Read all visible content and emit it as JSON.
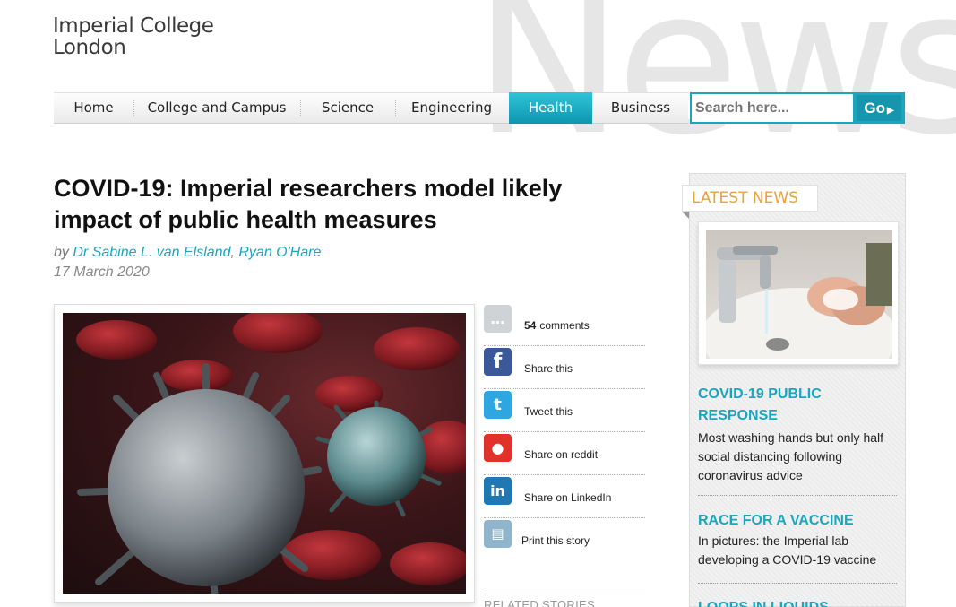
{
  "header": {
    "logo_line1": "Imperial College",
    "logo_line2": "London",
    "watermark": "News"
  },
  "nav": {
    "items": [
      {
        "label": "Home",
        "active": false
      },
      {
        "label": "College and Campus",
        "active": false
      },
      {
        "label": "Science",
        "active": false
      },
      {
        "label": "Engineering",
        "active": false
      },
      {
        "label": "Health",
        "active": true
      },
      {
        "label": "Business",
        "active": false
      }
    ],
    "search_placeholder": "Search here...",
    "search_button": "Go",
    "accent_color": "#1aa6bf"
  },
  "article": {
    "headline": "COVID-19: Imperial researchers model likely impact of public health measures",
    "by_label": "by",
    "author1": "Dr Sabine L. van Elsland",
    "author_sep": ",",
    "author2": "Ryan O'Hare",
    "date": "17 March 2020",
    "image_icon": "coronavirus-image"
  },
  "share": {
    "comments_count": "54",
    "comments_label": "comments",
    "items": [
      {
        "label": "Share this",
        "icon": "facebook-icon",
        "color": "#3b5998"
      },
      {
        "label": "Tweet this",
        "icon": "twitter-icon",
        "color": "#2ea7e0"
      },
      {
        "label": "Share on reddit",
        "icon": "reddit-icon",
        "color": "#e0312b"
      },
      {
        "label": "Share on LinkedIn",
        "icon": "linkedin-icon",
        "color": "#1f77b4"
      },
      {
        "label": "Print this story",
        "icon": "print-icon",
        "color": "#8fb4cc"
      }
    ],
    "related_label": "RELATED STORIES"
  },
  "sidebar": {
    "title": "LATEST NEWS",
    "title_color": "#e8a23c",
    "image_icon": "handwashing-image",
    "news": [
      {
        "category": "COVID-19 PUBLIC RESPONSE",
        "text": "Most washing hands but only half social distancing following coronavirus advice"
      },
      {
        "category": "RACE FOR A VACCINE",
        "text": "In pictures: the Imperial lab developing a COVID-19 vaccine"
      },
      {
        "category": "LOOPS IN LIQUIDS",
        "text": ""
      }
    ]
  }
}
